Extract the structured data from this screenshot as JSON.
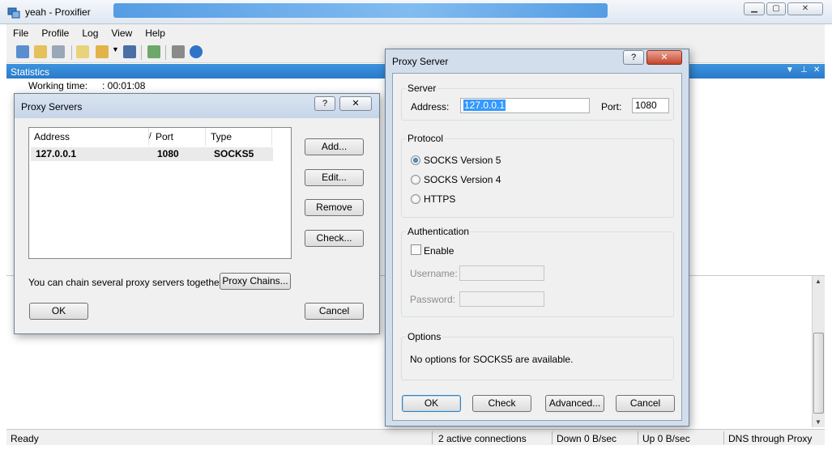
{
  "main_window": {
    "title": "yeah - Proxifier",
    "menu": [
      "File",
      "Profile",
      "Log",
      "View",
      "Help"
    ],
    "statistics_label": "Statistics",
    "working_time_label": "Working time:",
    "working_time_value": ": 00:01:08",
    "status": {
      "ready": "Ready",
      "connections": "2 active connections",
      "down": "Down 0 B/sec",
      "up": "Up 0 B/sec",
      "dns": "DNS through Proxy"
    }
  },
  "proxy_servers_dialog": {
    "title": "Proxy Servers",
    "columns": [
      "Address",
      "Port",
      "Type"
    ],
    "rows": [
      {
        "address": "127.0.0.1",
        "port": "1080",
        "type": "SOCKS5"
      }
    ],
    "buttons": {
      "add": "Add...",
      "edit": "Edit...",
      "remove": "Remove",
      "check": "Check...",
      "proxy_chains": "Proxy Chains...",
      "ok": "OK",
      "cancel": "Cancel"
    },
    "chain_text": "You can chain several proxy servers together:",
    "help": "?"
  },
  "proxy_server_dialog": {
    "title": "Proxy Server",
    "server_group": "Server",
    "address_label": "Address:",
    "address_value": "127.0.0.1",
    "port_label": "Port:",
    "port_value": "1080",
    "protocol_group": "Protocol",
    "protocols": [
      {
        "label": "SOCKS Version 5",
        "checked": true
      },
      {
        "label": "SOCKS Version 4",
        "checked": false
      },
      {
        "label": "HTTPS",
        "checked": false
      }
    ],
    "auth_group": "Authentication",
    "enable_label": "Enable",
    "username_label": "Username:",
    "password_label": "Password:",
    "options_group": "Options",
    "options_text": "No options for SOCKS5 are available.",
    "buttons": {
      "ok": "OK",
      "check": "Check",
      "advanced": "Advanced...",
      "cancel": "Cancel"
    },
    "help": "?"
  },
  "colors": {
    "title_accent": "#2a7bcb",
    "selection": "#3399ff"
  }
}
